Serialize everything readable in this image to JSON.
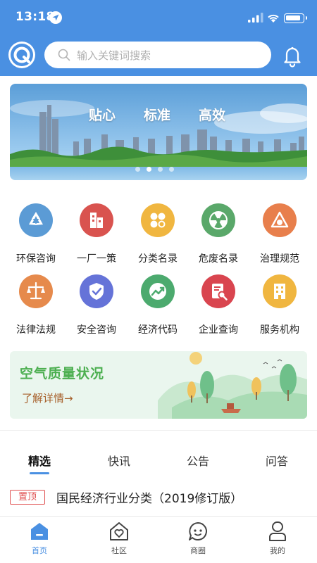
{
  "status_bar": {
    "time": "13:18"
  },
  "search": {
    "placeholder": "输入关键词搜索"
  },
  "banner": {
    "slogans": [
      "贴心",
      "标准",
      "高效"
    ]
  },
  "services": [
    {
      "label": "环保咨询",
      "icon": "recycle-icon",
      "color": "#5b9bd5"
    },
    {
      "label": "一厂一策",
      "icon": "factory-icon",
      "color": "#d9534f"
    },
    {
      "label": "分类名录",
      "icon": "category-icon",
      "color": "#f0b640"
    },
    {
      "label": "危废名录",
      "icon": "hazard-icon",
      "color": "#5aa86a"
    },
    {
      "label": "治理规范",
      "icon": "governance-icon",
      "color": "#e87f4c"
    },
    {
      "label": "法律法规",
      "icon": "scales-icon",
      "color": "#e68a4c"
    },
    {
      "label": "安全咨询",
      "icon": "shield-icon",
      "color": "#6573d8"
    },
    {
      "label": "经济代码",
      "icon": "trend-icon",
      "color": "#4caa6e"
    },
    {
      "label": "企业查询",
      "icon": "enterprise-search-icon",
      "color": "#d9454f"
    },
    {
      "label": "服务机构",
      "icon": "building-icon",
      "color": "#f0b640"
    }
  ],
  "air_quality": {
    "title": "空气质量状况",
    "link": "了解详情→"
  },
  "tabs": [
    {
      "label": "精选",
      "active": true
    },
    {
      "label": "快讯",
      "active": false
    },
    {
      "label": "公告",
      "active": false
    },
    {
      "label": "问答",
      "active": false
    }
  ],
  "news": [
    {
      "badge": "置顶",
      "title": "国民经济行业分类（2019修订版）"
    }
  ],
  "bottom_nav": [
    {
      "label": "首页",
      "icon": "home-icon",
      "active": true
    },
    {
      "label": "社区",
      "icon": "community-icon",
      "active": false
    },
    {
      "label": "商圈",
      "icon": "chat-icon",
      "active": false
    },
    {
      "label": "我的",
      "icon": "profile-icon",
      "active": false
    }
  ],
  "colors": {
    "brand": "#4a90e2",
    "pin_red": "#e05252",
    "air_green": "#4caf50",
    "air_link": "#a65f2a"
  }
}
